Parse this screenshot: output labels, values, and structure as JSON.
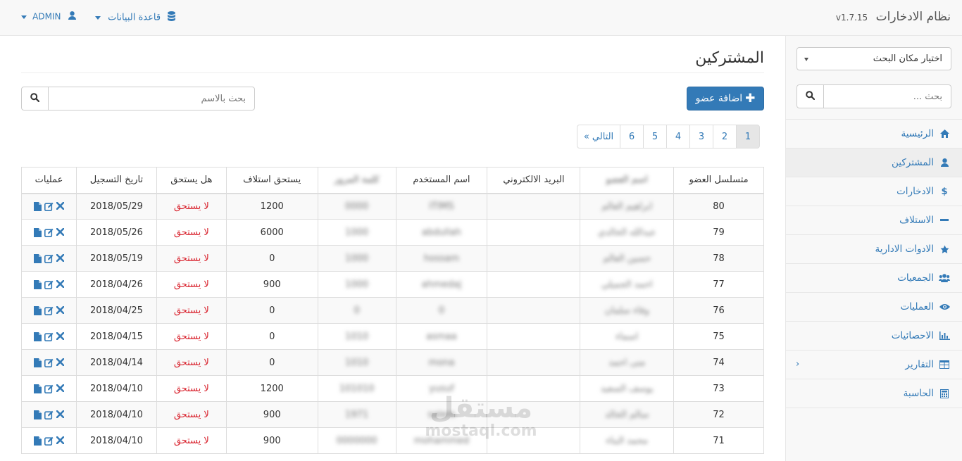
{
  "brand": {
    "title": "نظام الادخارات",
    "version": "v1.7.15"
  },
  "topnav": {
    "database_label": "قاعدة البيانات",
    "user_label": "ADMIN"
  },
  "sidebar": {
    "location_select": "اختيار مكان البحث",
    "search_placeholder": "بحث ...",
    "items": [
      {
        "label": "الرئيسية",
        "icon": "home-icon"
      },
      {
        "label": "المشتركين",
        "icon": "user-icon",
        "active": true
      },
      {
        "label": "الادخارات",
        "icon": "dollar-icon"
      },
      {
        "label": "الاستلاف",
        "icon": "minus-icon"
      },
      {
        "label": "الادوات الادارية",
        "icon": "star-icon"
      },
      {
        "label": "الجمعيات",
        "icon": "users-icon"
      },
      {
        "label": "العمليات",
        "icon": "eye-icon"
      },
      {
        "label": "الاحصائيات",
        "icon": "bar-chart-icon"
      },
      {
        "label": "التقارير",
        "icon": "table-icon",
        "has_submenu": true
      },
      {
        "label": "الحاسبة",
        "icon": "calculator-icon"
      }
    ]
  },
  "main": {
    "title": "المشتركين",
    "search_placeholder": "بحث بالاسم",
    "add_button": "اضافة عضو",
    "pagination": {
      "pages": [
        "1",
        "2",
        "3",
        "4",
        "5",
        "6"
      ],
      "current": "1",
      "next_label": "التالي »"
    },
    "table": {
      "headers": [
        "متسلسل العضو",
        "اسم العضو",
        "البريد الالكتروني",
        "اسم المستخدم",
        "كلمة المرور",
        "يستحق استلاف",
        "هل يستحق",
        "تاريخ التسجيل",
        "عمليات"
      ],
      "rows": [
        {
          "id": "80",
          "name": "ابراهيم العالم",
          "email": "",
          "username": "ITIMS",
          "password": "0000",
          "loan": "1200",
          "eligible": "لا يستحق",
          "date": "2018/05/29"
        },
        {
          "id": "79",
          "name": "عبدالله الخالدي",
          "email": "",
          "username": "abdullah",
          "password": "1000",
          "loan": "6000",
          "eligible": "لا يستحق",
          "date": "2018/05/26"
        },
        {
          "id": "78",
          "name": "حسين العالم",
          "email": "",
          "username": "hossam",
          "password": "1000",
          "loan": "0",
          "eligible": "لا يستحق",
          "date": "2018/05/19"
        },
        {
          "id": "77",
          "name": "احمد الجميلي",
          "email": "",
          "username": "ahmedaj",
          "password": "1000",
          "loan": "900",
          "eligible": "لا يستحق",
          "date": "2018/04/26"
        },
        {
          "id": "76",
          "name": "وفاء سلمان",
          "email": "",
          "username": "0",
          "password": "0",
          "loan": "0",
          "eligible": "لا يستحق",
          "date": "2018/04/25"
        },
        {
          "id": "75",
          "name": "اسماء",
          "email": "",
          "username": "asmaa",
          "password": "1010",
          "loan": "0",
          "eligible": "لا يستحق",
          "date": "2018/04/15"
        },
        {
          "id": "74",
          "name": "منى احمد",
          "email": "",
          "username": "mona",
          "password": "1010",
          "loan": "0",
          "eligible": "لا يستحق",
          "date": "2018/04/14"
        },
        {
          "id": "73",
          "name": "يوسف السعيد",
          "email": "",
          "username": "yusuf",
          "password": "101010",
          "loan": "1200",
          "eligible": "لا يستحق",
          "date": "2018/04/10"
        },
        {
          "id": "72",
          "name": "سالم الخالد",
          "email": "",
          "username": "salem",
          "password": "1971",
          "loan": "900",
          "eligible": "لا يستحق",
          "date": "2018/04/10"
        },
        {
          "id": "71",
          "name": "محمد البناء",
          "email": "",
          "username": "mohammed",
          "password": "0000000",
          "loan": "900",
          "eligible": "لا يستحق",
          "date": "2018/04/10"
        }
      ]
    }
  },
  "watermark": {
    "arabic": "مستقل",
    "latin": "mostaql.com"
  },
  "colors": {
    "link": "#337ab7",
    "danger": "#d9232e",
    "primary_button": "#337ab7"
  }
}
